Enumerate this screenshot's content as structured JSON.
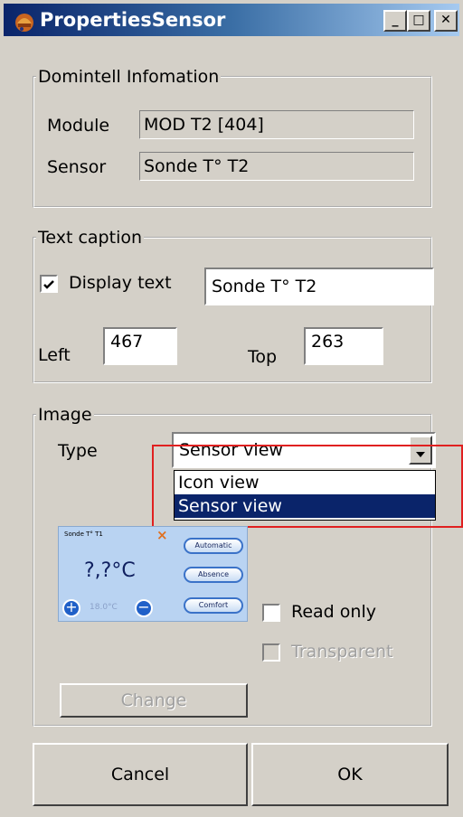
{
  "window": {
    "title": "PropertiesSensor",
    "minimize": "_",
    "maximize": "□",
    "close": "✕"
  },
  "domintell": {
    "legend": "Domintell Infomation",
    "module_label": "Module",
    "module_value": "MOD T2 [404]",
    "sensor_label": "Sensor",
    "sensor_value": "Sonde T° T2"
  },
  "text_caption": {
    "legend": "Text caption",
    "display_text_label": "Display text",
    "display_text_checked": true,
    "display_text_value": "Sonde T° T2",
    "left_label": "Left",
    "left_value": "467",
    "top_label": "Top",
    "top_value": "263"
  },
  "image": {
    "legend": "Image",
    "type_label": "Type",
    "type_selected": "Sensor view",
    "type_options": [
      "Icon view",
      "Sensor view"
    ],
    "preview": {
      "title": "Sonde T° T1",
      "temperature": "?,?°C",
      "setpoint": "18.0°C",
      "buttons": [
        "Automatic",
        "Absence",
        "Comfort"
      ]
    },
    "read_only_label": "Read only",
    "transparent_label": "Transparent",
    "change_label": "Change"
  },
  "footer": {
    "cancel_label": "Cancel",
    "ok_label": "OK"
  },
  "colors": {
    "title_active": "#0a246a",
    "selection": "#0a246a",
    "highlight_box": "#e02020",
    "preview_bg": "#b9d3f2"
  }
}
